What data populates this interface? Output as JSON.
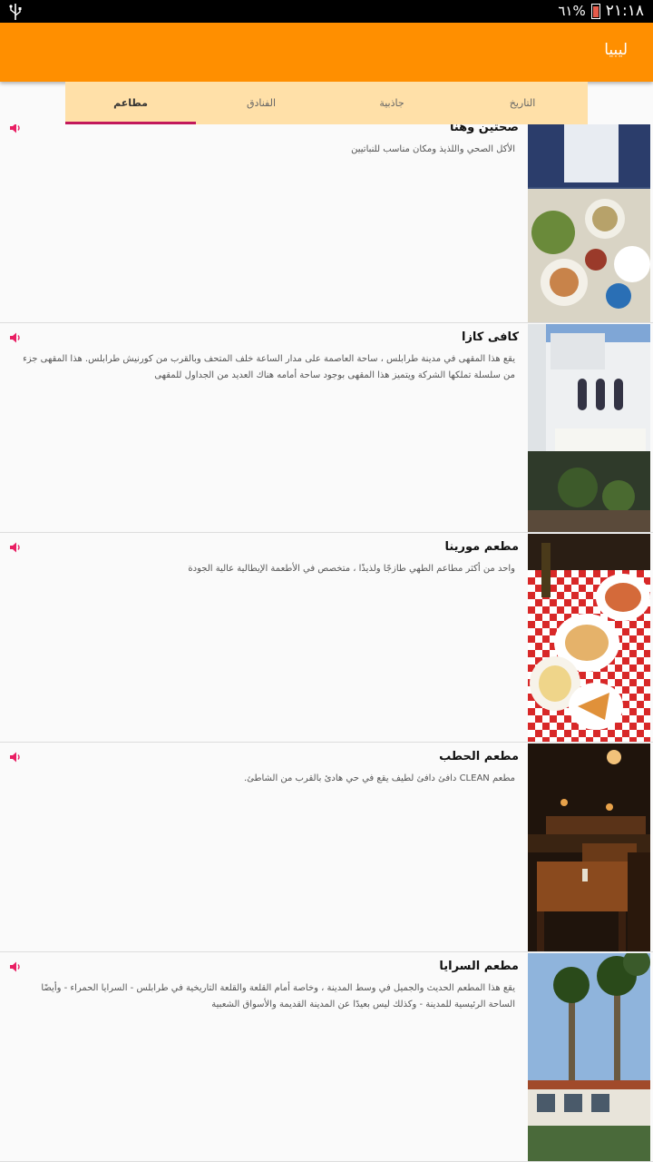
{
  "status": {
    "time": "٢١:١٨",
    "battery": "٦١%"
  },
  "appbar": {
    "title": "ليبيا"
  },
  "tabs": [
    {
      "label": "التاريخ"
    },
    {
      "label": "جاذبية"
    },
    {
      "label": "الفنادق"
    },
    {
      "label": "مطاعم"
    }
  ],
  "items": [
    {
      "name": "صحتين وهنا",
      "desc": "الأكل الصحي واللذيذ ومكان مناسب للنباتيين"
    },
    {
      "name": "كافى كازا",
      "desc": "يقع هذا المقهى في مدينة طرابلس ، ساحة العاصمة على مدار الساعة خلف المتحف وبالقرب من كورنيش طرابلس. هذا المقهى جزء من سلسلة تملكها الشركة ويتميز هذا المقهى بوجود ساحة أمامه هناك العديد من الجداول للمقهى"
    },
    {
      "name": "مطعم مورينا",
      "desc": "واحد من أكثر مطاعم الطهي طازجًا ولذيذًا ، متخصص في الأطعمة الإيطالية عالية الجودة"
    },
    {
      "name": "مطعم الحطب",
      "desc": "مطعم CLEAN دافئ دافئ لطيف يقع في حي هادئ بالقرب من الشاطئ."
    },
    {
      "name": "مطعم السرايا",
      "desc": "يقع هذا المطعم الحديث والجميل في وسط المدينة ، وخاصة أمام القلعة والقلعة التاريخية في طرابلس - السرايا الحمراء - وأيضًا الساحة الرئيسية للمدينة - وكذلك ليس بعيدًا عن المدينة القديمة والأسواق الشعبية"
    }
  ],
  "colors": {
    "appbar": "#ff8f00",
    "tabs_bg": "#ffe0a8",
    "indicator": "#c2185b",
    "speaker": "#e91e63"
  }
}
